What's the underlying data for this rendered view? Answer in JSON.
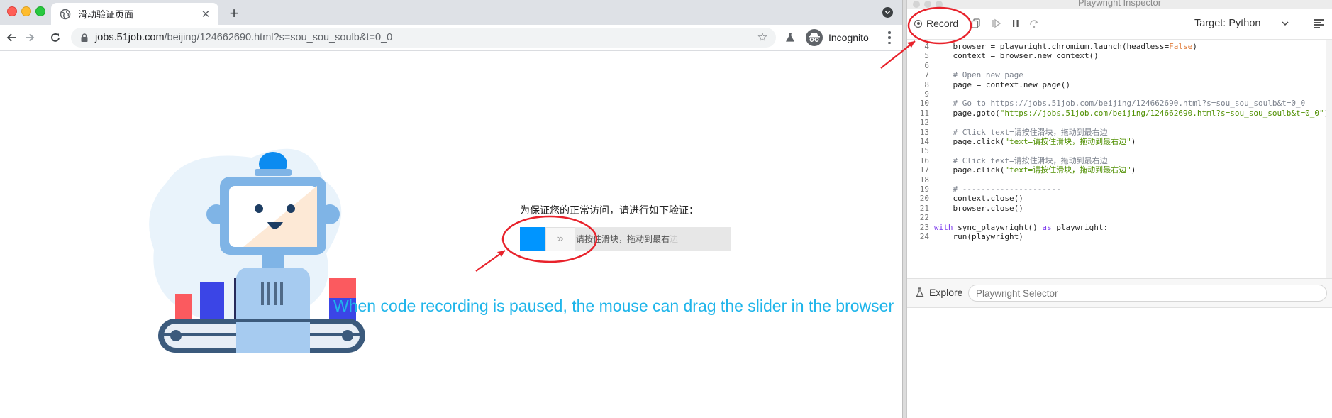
{
  "browser": {
    "tab_title": "滑动验证页面",
    "tab_close": "✕",
    "new_tab": "+",
    "url_domain": "jobs.51job.com",
    "url_path": "/beijing/124662690.html?s=sou_sou_soulb&t=0_0",
    "incognito_label": "Incognito"
  },
  "page": {
    "verify_prompt": "为保证您的正常访问，请进行如下验证：",
    "slider_arrows": "»",
    "slider_hint": "请按住滑块，拖动到最右",
    "slider_hint_fade": "边",
    "caption": "When code recording is paused, the mouse can drag the slider in the browser",
    "caption_color": "#1fb5ea",
    "slider_color": "#0095ff"
  },
  "inspector": {
    "window_title": "Playwright Inspector",
    "record_label": "Record",
    "target_label": "Target:",
    "target_value": "Python",
    "explore_label": "Explore",
    "selector_placeholder": "Playwright Selector",
    "code_lines": [
      {
        "n": "4",
        "t": "    browser = playwright.chromium.launch(headless=False)"
      },
      {
        "n": "5",
        "t": "    context = browser.new_context()"
      },
      {
        "n": "6",
        "t": ""
      },
      {
        "n": "7",
        "t": "    # Open new page"
      },
      {
        "n": "8",
        "t": "    page = context.new_page()"
      },
      {
        "n": "9",
        "t": ""
      },
      {
        "n": "10",
        "t": "    # Go to https://jobs.51job.com/beijing/124662690.html?s=sou_sou_soulb&t=0_0"
      },
      {
        "n": "11",
        "t": "    page.goto(\"https://jobs.51job.com/beijing/124662690.html?s=sou_sou_soulb&t=0_0\")"
      },
      {
        "n": "12",
        "t": ""
      },
      {
        "n": "13",
        "t": "    # Click text=请按住滑块，拖动到最右边"
      },
      {
        "n": "14",
        "t": "    page.click(\"text=请按住滑块，拖动到最右边\")"
      },
      {
        "n": "15",
        "t": ""
      },
      {
        "n": "16",
        "t": "    # Click text=请按住滑块，拖动到最右边"
      },
      {
        "n": "17",
        "t": "    page.click(\"text=请按住滑块，拖动到最右边\")"
      },
      {
        "n": "18",
        "t": ""
      },
      {
        "n": "19",
        "t": "    # ---------------------"
      },
      {
        "n": "20",
        "t": "    context.close()"
      },
      {
        "n": "21",
        "t": "    browser.close()"
      },
      {
        "n": "22",
        "t": ""
      },
      {
        "n": "23",
        "t": "with sync_playwright() as playwright:"
      },
      {
        "n": "24",
        "t": "    run(playwright)"
      }
    ]
  },
  "annotation": {
    "color": "#e8222b"
  }
}
